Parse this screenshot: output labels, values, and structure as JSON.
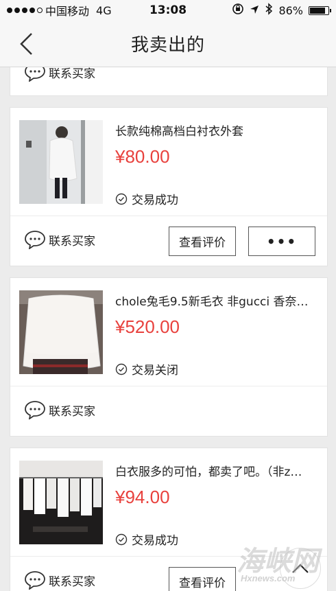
{
  "status_bar": {
    "carrier": "中国移动",
    "network": "4G",
    "time": "13:08",
    "battery": "86%",
    "battery_level": 0.86
  },
  "nav": {
    "title": "我卖出的"
  },
  "contact_label": "联系买家",
  "orders": [
    {
      "title": "长款纯棉高档白衬衣外套",
      "price": "¥80.00",
      "status": "交易成功",
      "review_button": "查看评价",
      "more_button": "•••"
    },
    {
      "title": "chole兔毛9.5新毛衣 非gucci 香奈…",
      "price": "¥520.00",
      "status": "交易关闭"
    },
    {
      "title": "白衣服多的可怕，都卖了吧。（非z…",
      "price": "¥94.00",
      "status": "交易成功",
      "review_button": "查看评价"
    }
  ],
  "watermark": {
    "main": "海峡网",
    "sub": "Hxnews.com"
  },
  "colors": {
    "price": "#e8413d",
    "background": "#ececec"
  }
}
